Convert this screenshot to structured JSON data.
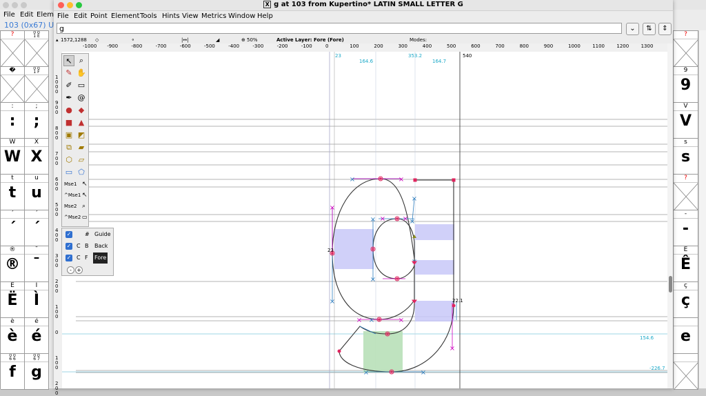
{
  "background_window": {
    "menu": [
      "File",
      "Edit",
      "Eleme"
    ],
    "info": "103 (0x67) U+",
    "left_columns": [
      {
        "label": "?",
        "label_red": true,
        "glyph": "",
        "codes": "0 0\n1 E"
      },
      {
        "label": "�",
        "label_red": false,
        "glyph": "",
        "codes": "0 0\n1 F"
      },
      {
        "label": ":",
        "glyph": ":",
        "label2": ";",
        "glyph2": ";"
      },
      {
        "label": "W",
        "glyph": "W",
        "label2": "X",
        "glyph2": "X"
      },
      {
        "label": "t",
        "glyph": "t",
        "label2": "u",
        "glyph2": "u"
      },
      {
        "label": "ˊ",
        "glyph": "´",
        "label2": "ˊ",
        "glyph2": "´"
      },
      {
        "label": "®",
        "glyph": "®",
        "label2": "¯",
        "glyph2": "¯"
      },
      {
        "label": "Ë",
        "glyph": "Ë",
        "label2": "Ì",
        "glyph2": "Ì"
      },
      {
        "label": "è",
        "glyph": "è",
        "label2": "é",
        "glyph2": "é"
      },
      {
        "label": "0 0\n6 6",
        "glyph": "f",
        "label2": "0 0\n6 7",
        "glyph2": "g"
      }
    ],
    "right_column": [
      {
        "label": "?",
        "label_red": true,
        "glyph": ""
      },
      {
        "label": "9",
        "glyph": "9"
      },
      {
        "label": "V",
        "glyph": "V"
      },
      {
        "label": "s",
        "glyph": "s"
      },
      {
        "label": "?",
        "label_red": true,
        "glyph": ""
      },
      {
        "label": "-",
        "glyph": "-"
      },
      {
        "label": "Ê",
        "glyph": "Ê"
      },
      {
        "label": "ç",
        "glyph": "ç"
      },
      {
        "label": "",
        "glyph": "e"
      },
      {
        "label": "",
        "glyph": ""
      }
    ]
  },
  "window": {
    "title": "g at 103 from Kupertino* LATIN SMALL LETTER G",
    "menu": [
      "File",
      "Edit",
      "Point",
      "Element",
      "Tools",
      "Hints",
      "View",
      "Metrics",
      "Window",
      "Help"
    ],
    "glyph_field_value": "g",
    "info": {
      "coords": "1572,1288",
      "zoom": "50%",
      "active_layer": "Active Layer: Fore (Fore)",
      "modes": "Modes:"
    },
    "ruler_ticks": [
      "-1000",
      "-900",
      "-800",
      "-700",
      "-600",
      "-500",
      "-400",
      "-300",
      "-200",
      "-100",
      "0",
      "100",
      "200",
      "300",
      "400",
      "500",
      "600",
      "700",
      "800",
      "900",
      "1000",
      "1100",
      "1200",
      "1300"
    ],
    "canvas_labels": {
      "lsb": "23",
      "stem1": "164.6",
      "pos2": "353.2",
      "stem2": "164.7",
      "width": "540",
      "point_left": "23",
      "point_right": "22.1",
      "hint_y": "154.6",
      "descender": "-226.7"
    },
    "vruler_labels": [
      "1\n0\n0\n0",
      "9\n0\n0",
      "8\n0\n0",
      "7\n0\n0",
      "6\n0\n0",
      "5\n0\n0",
      "4\n0\n0",
      "3\n0\n0",
      "2\n0\n0",
      "1\n0\n0",
      "0",
      "1\n0\n0",
      "2\n0\n0"
    ],
    "tools_mse": [
      "Mse1",
      "^Mse1",
      "Mse2",
      "^Mse2"
    ],
    "layers": [
      {
        "code1": "#",
        "code2": "",
        "name": "Guide"
      },
      {
        "code1": "C",
        "code2": "B",
        "name": "Back"
      },
      {
        "code1": "C",
        "code2": "F",
        "name": "Fore"
      }
    ],
    "layer_buttons": [
      "-",
      "+"
    ]
  },
  "colors": {
    "guide_line": "#888888",
    "outline": "#333333",
    "point_red": "#e0245e",
    "point_magenta": "#d000c0",
    "handle_blue": "#2f7fc0",
    "hint_blue": "#c8c8f8",
    "hint_green": "#b8e0b8",
    "metric_cyan": "#1aa8c8"
  }
}
